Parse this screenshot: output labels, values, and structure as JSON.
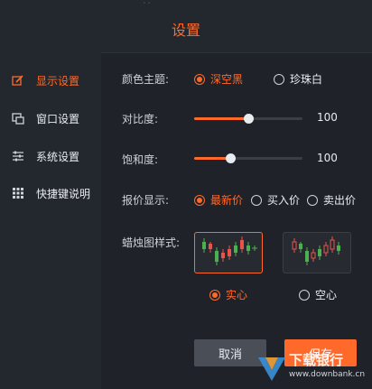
{
  "header": {
    "title": "设置"
  },
  "sidebar": {
    "items": [
      {
        "label": "显示设置",
        "icon": "edit-icon",
        "active": true
      },
      {
        "label": "窗口设置",
        "icon": "window-icon",
        "active": false
      },
      {
        "label": "系统设置",
        "icon": "sliders-icon",
        "active": false
      },
      {
        "label": "快捷键说明",
        "icon": "grid-icon",
        "active": false
      }
    ]
  },
  "settings": {
    "theme": {
      "label": "颜色主题:",
      "options": [
        "深空黑",
        "珍珠白"
      ],
      "selected": "深空黑"
    },
    "contrast": {
      "label": "对比度:",
      "value": 100,
      "level": 0.5
    },
    "saturation": {
      "label": "饱和度:",
      "value": 100,
      "level": 0.33
    },
    "quote": {
      "label": "报价显示:",
      "options": [
        "最新价",
        "买入价",
        "卖出价"
      ],
      "selected": "最新价"
    },
    "candle": {
      "label": "蜡烛图样式:",
      "options": [
        "实心",
        "空心"
      ],
      "selected": "实心"
    }
  },
  "footer": {
    "cancel_label": "取消",
    "save_label": "保存"
  },
  "watermark": {
    "text": "下载银行",
    "url": "www.downbank.cn"
  },
  "colors": {
    "accent": "#ff6a2b",
    "up": "#e8534a",
    "down": "#4caf50"
  }
}
